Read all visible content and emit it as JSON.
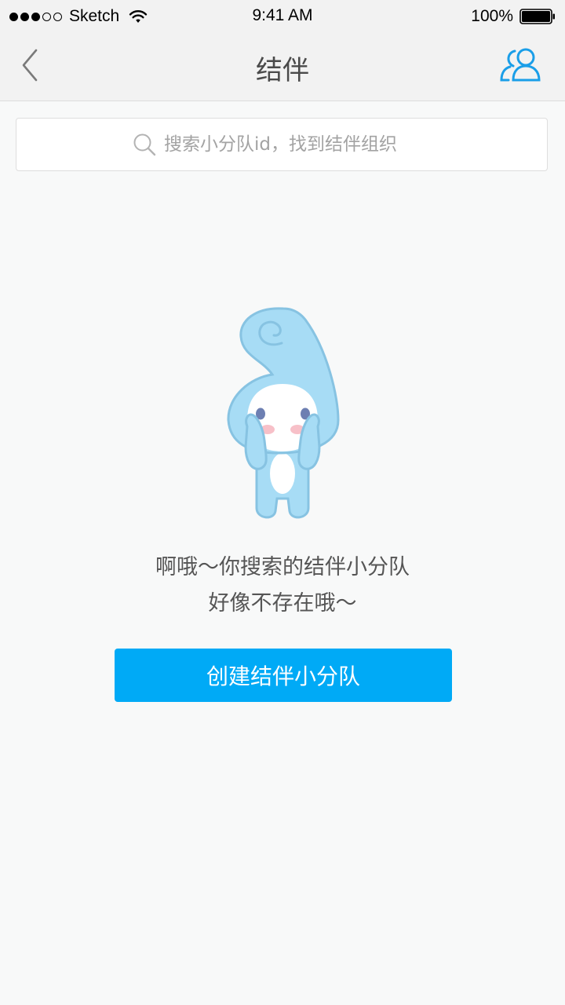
{
  "status_bar": {
    "carrier": "Sketch",
    "time": "9:41 AM",
    "battery": "100%",
    "icons": [
      "signal-dots",
      "wifi-icon",
      "battery-icon"
    ]
  },
  "nav": {
    "title": "结伴",
    "back_icon": "chevron-left-icon",
    "right_icon": "group-users-icon",
    "accent_color": "#1a9ee8"
  },
  "search": {
    "placeholder": "搜索小分队id，找到结伴组织",
    "value": "",
    "icon": "search-icon"
  },
  "empty_state": {
    "illustration": "shy-mascot-illustration",
    "line1": "啊哦～你搜索的结伴小分队",
    "line2": "好像不存在哦～"
  },
  "actions": {
    "create_label": "创建结伴小分队",
    "create_color": "#00aaf6"
  }
}
